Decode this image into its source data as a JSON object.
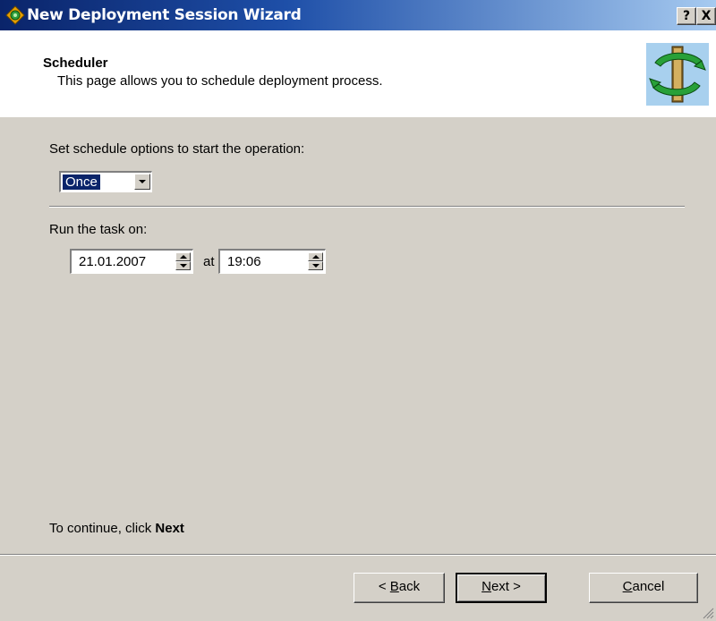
{
  "window": {
    "title": "New Deployment Session Wizard",
    "help_btn": "?",
    "close_btn": "X"
  },
  "header": {
    "title": "Scheduler",
    "subtitle": "This page allows you to schedule deployment process."
  },
  "schedule": {
    "label": "Set schedule options to start the operation:",
    "frequency": "Once"
  },
  "run": {
    "label": "Run the task on:",
    "date": "21.01.2007",
    "at_label": "at",
    "time": "19:06"
  },
  "footer": {
    "continue_prefix": "To continue, click ",
    "continue_bold": "Next"
  },
  "buttons": {
    "back_pre": "< ",
    "back_u": "B",
    "back_rest": "ack",
    "next_u": "N",
    "next_rest": "ext >",
    "cancel_u": "C",
    "cancel_rest": "ancel"
  },
  "colors": {
    "titlebar": "#0a246a",
    "dialog_bg": "#d4d0c8",
    "selection": "#0a246a"
  }
}
